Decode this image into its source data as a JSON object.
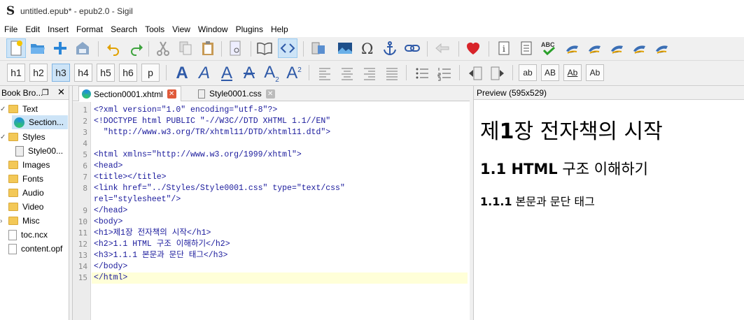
{
  "window": {
    "title": "untitled.epub* - epub2.0 - Sigil",
    "app_icon": "S"
  },
  "menu": [
    "File",
    "Edit",
    "Insert",
    "Format",
    "Search",
    "Tools",
    "View",
    "Window",
    "Plugins",
    "Help"
  ],
  "heading_buttons": [
    "h1",
    "h2",
    "h3",
    "h4",
    "h5",
    "h6",
    "p"
  ],
  "case_buttons": [
    "ab",
    "AB",
    "Ab",
    "Ab"
  ],
  "book_browser": {
    "title": "Book Bro...",
    "items": [
      "Text",
      "Section...",
      "Styles",
      "Style00...",
      "Images",
      "Fonts",
      "Audio",
      "Video",
      "Misc",
      "toc.ncx",
      "content.opf"
    ]
  },
  "tabs": [
    "Section0001.xhtml",
    "Style0001.css"
  ],
  "line_numbers": [
    "1",
    "2",
    "3",
    "4",
    "5",
    "6",
    "7",
    "8",
    "",
    "9",
    "10",
    "11",
    "12",
    "13",
    "14",
    "15"
  ],
  "code": {
    "l1": "<?xml version=\"1.0\" encoding=\"utf-8\"?>",
    "l2": "<!DOCTYPE html PUBLIC \"-//W3C//DTD XHTML 1.1//EN\"",
    "l2b": "  \"http://www.w3.org/TR/xhtml11/DTD/xhtml11.dtd\">",
    "l5": "<html xmlns=\"http://www.w3.org/1999/xhtml\">",
    "l6": "<head>",
    "l7": "<title></title>",
    "l8": "<link href=\"../Styles/Style0001.css\" type=\"text/css\"",
    "l8b": "rel=\"stylesheet\"/>",
    "l9": "</head>",
    "l10": "<body>",
    "l11": "<h1>제1장 전자책의 시작</h1>",
    "l12": "<h2>1.1 HTML 구조 이해하기</h2>",
    "l13": "<h3>1.1.1 본문과 문단 태그</h3>",
    "l14": "</body>",
    "l15": "</html>"
  },
  "preview": {
    "title": "Preview (595x529)",
    "h1_pre": "제",
    "h1_num": "1",
    "h1_post": "장 전자책의 시작",
    "h2_bold": "1.1 HTML",
    "h2_rest": " 구조 이해하기",
    "h3_bold": "1.1.1",
    "h3_rest": " 본문과 문단 태그"
  }
}
